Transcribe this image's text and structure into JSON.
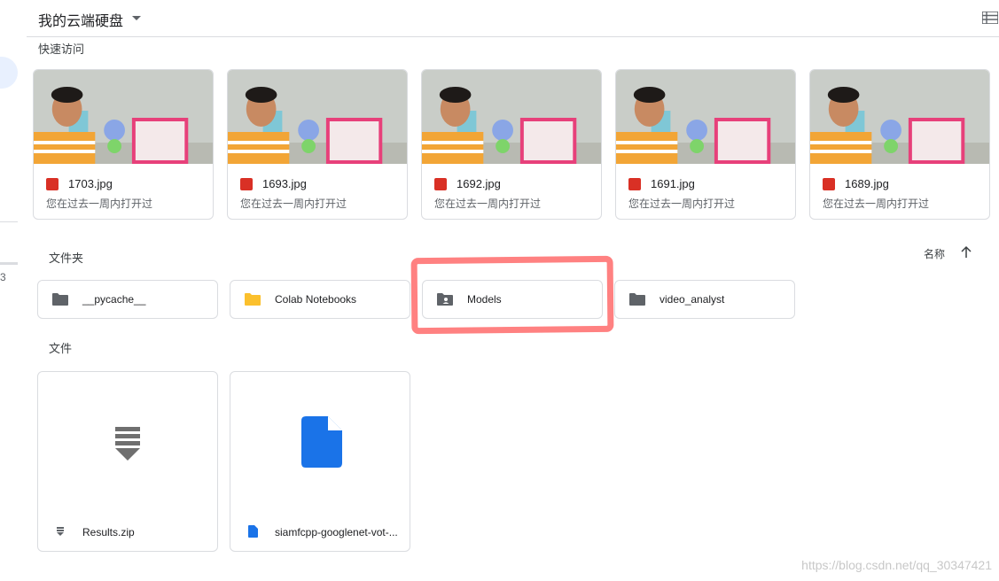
{
  "header": {
    "title": "我的云端硬盘"
  },
  "quick_access": {
    "label": "快速访问",
    "items": [
      {
        "name": "1703.jpg",
        "subtitle": "您在过去一周内打开过"
      },
      {
        "name": "1693.jpg",
        "subtitle": "您在过去一周内打开过"
      },
      {
        "name": "1692.jpg",
        "subtitle": "您在过去一周内打开过"
      },
      {
        "name": "1691.jpg",
        "subtitle": "您在过去一周内打开过"
      },
      {
        "name": "1689.jpg",
        "subtitle": "您在过去一周内打开过"
      }
    ]
  },
  "folders": {
    "label": "文件夹",
    "sort_label": "名称",
    "items": [
      {
        "name": "__pycache__",
        "icon": "folder-icon",
        "color": "#5f6368"
      },
      {
        "name": "Colab Notebooks",
        "icon": "folder-icon",
        "color": "#fbc02d"
      },
      {
        "name": "Models",
        "icon": "shared-folder-icon",
        "color": "#5f6368"
      },
      {
        "name": "video_analyst",
        "icon": "folder-icon",
        "color": "#5f6368"
      }
    ]
  },
  "files": {
    "label": "文件",
    "items": [
      {
        "name": "Results.zip",
        "icon": "zip-icon"
      },
      {
        "name": "siamfcpp-googlenet-vot-...",
        "icon": "doc-icon"
      }
    ]
  },
  "sidebar": {
    "fragment_text": "3"
  },
  "watermark": "https://blog.csdn.net/qq_30347421",
  "colors": {
    "highlight": "#ff7a7a",
    "image_icon": "#d93025",
    "doc_blue": "#1a73e8"
  }
}
